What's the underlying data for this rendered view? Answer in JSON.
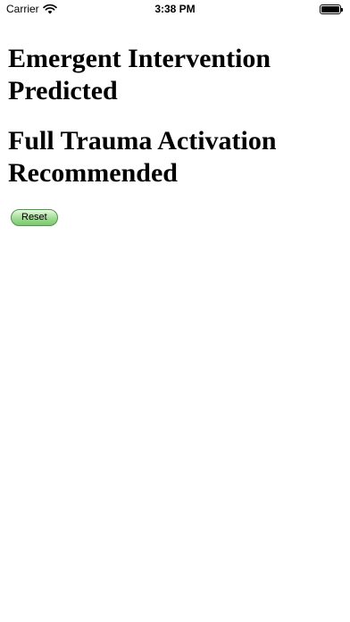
{
  "status_bar": {
    "carrier": "Carrier",
    "time": "3:38 PM",
    "wifi_icon": "wifi-icon",
    "battery_icon": "battery-full-icon"
  },
  "main": {
    "result_heading": "Emergent Intervention Predicted",
    "recommendation_heading": "Full Trauma Activation Recommended",
    "reset_label": "Reset"
  },
  "colors": {
    "reset_button_fill": "#9fdc93",
    "reset_button_border": "#5a8f55"
  }
}
